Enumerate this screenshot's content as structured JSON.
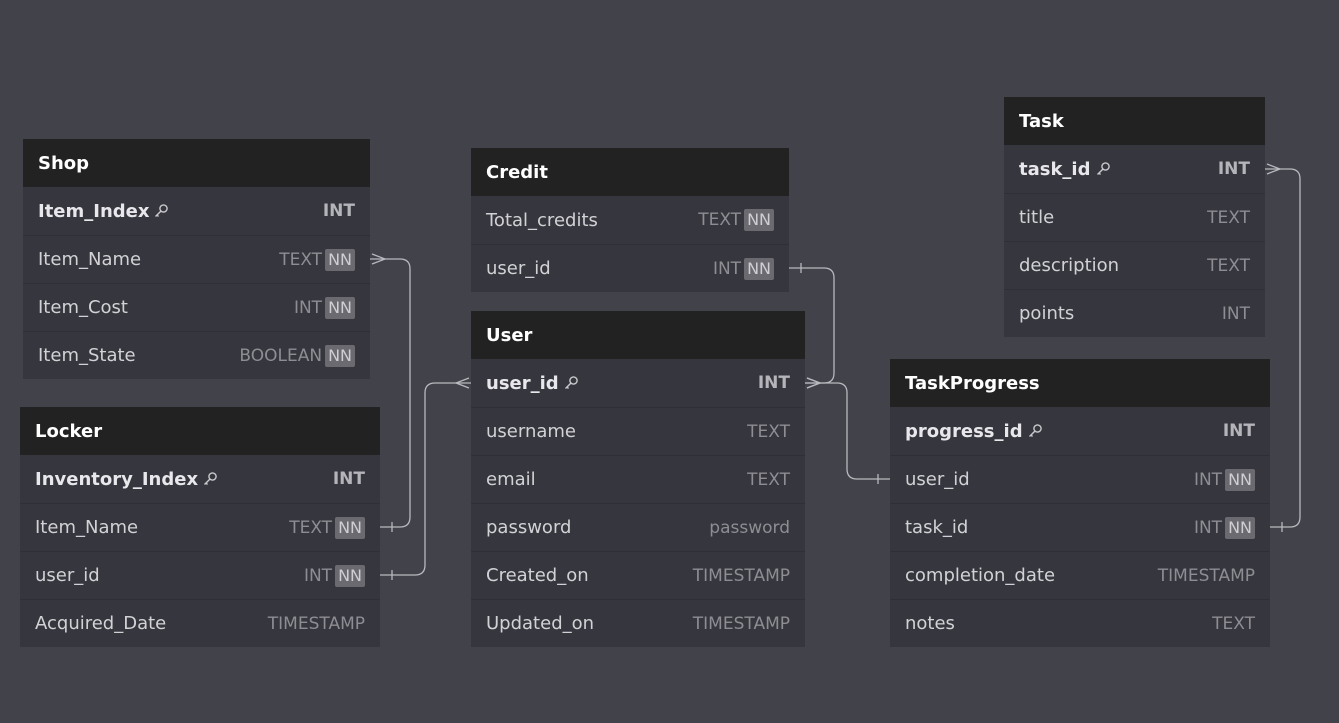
{
  "colors": {
    "canvas": "#42424b",
    "header_bg": "#222222",
    "row_bg": "#36363e",
    "link_stroke": "#b8b8be",
    "nn_badge": "#6a6a70"
  },
  "entities": {
    "shop": {
      "name": "Shop",
      "fields": [
        {
          "name": "Item_Index",
          "type": "INT",
          "nn": "",
          "pk": true
        },
        {
          "name": "Item_Name",
          "type": "TEXT",
          "nn": "NN",
          "pk": false
        },
        {
          "name": "Item_Cost",
          "type": "INT",
          "nn": "NN",
          "pk": false
        },
        {
          "name": "Item_State",
          "type": "BOOLEAN",
          "nn": "NN",
          "pk": false
        }
      ]
    },
    "locker": {
      "name": "Locker",
      "fields": [
        {
          "name": "Inventory_Index",
          "type": "INT",
          "nn": "",
          "pk": true
        },
        {
          "name": "Item_Name",
          "type": "TEXT",
          "nn": "NN",
          "pk": false
        },
        {
          "name": "user_id",
          "type": "INT",
          "nn": "NN",
          "pk": false
        },
        {
          "name": "Acquired_Date",
          "type": "TIMESTAMP",
          "nn": "",
          "pk": false
        }
      ]
    },
    "credit": {
      "name": "Credit",
      "fields": [
        {
          "name": "Total_credits",
          "type": "TEXT",
          "nn": "NN",
          "pk": false
        },
        {
          "name": "user_id",
          "type": "INT",
          "nn": "NN",
          "pk": false
        }
      ]
    },
    "user": {
      "name": "User",
      "fields": [
        {
          "name": "user_id",
          "type": "INT",
          "nn": "",
          "pk": true
        },
        {
          "name": "username",
          "type": "TEXT",
          "nn": "",
          "pk": false
        },
        {
          "name": "email",
          "type": "TEXT",
          "nn": "",
          "pk": false
        },
        {
          "name": "password",
          "type": "password",
          "nn": "",
          "pk": false
        },
        {
          "name": "Created_on",
          "type": "TIMESTAMP",
          "nn": "",
          "pk": false
        },
        {
          "name": "Updated_on",
          "type": "TIMESTAMP",
          "nn": "",
          "pk": false
        }
      ]
    },
    "task": {
      "name": "Task",
      "fields": [
        {
          "name": "task_id",
          "type": "INT",
          "nn": "",
          "pk": true
        },
        {
          "name": "title",
          "type": "TEXT",
          "nn": "",
          "pk": false
        },
        {
          "name": "description",
          "type": "TEXT",
          "nn": "",
          "pk": false
        },
        {
          "name": "points",
          "type": "INT",
          "nn": "",
          "pk": false
        }
      ]
    },
    "taskprogress": {
      "name": "TaskProgress",
      "fields": [
        {
          "name": "progress_id",
          "type": "INT",
          "nn": "",
          "pk": true
        },
        {
          "name": "user_id",
          "type": "INT",
          "nn": "NN",
          "pk": false
        },
        {
          "name": "task_id",
          "type": "INT",
          "nn": "NN",
          "pk": false
        },
        {
          "name": "completion_date",
          "type": "TIMESTAMP",
          "nn": "",
          "pk": false
        },
        {
          "name": "notes",
          "type": "TEXT",
          "nn": "",
          "pk": false
        }
      ]
    }
  },
  "relationships": [
    {
      "from": "shop.Item_Name",
      "from_end": "many",
      "to": "locker.Item_Name",
      "to_end": "one"
    },
    {
      "from": "user.user_id",
      "from_end": "many",
      "to": "locker.user_id",
      "to_end": "one"
    },
    {
      "from": "user.user_id",
      "from_end": "many",
      "to": "credit.user_id",
      "to_end": "one"
    },
    {
      "from": "user.user_id",
      "from_end": "many",
      "to": "taskprogress.user_id",
      "to_end": "one"
    },
    {
      "from": "task.task_id",
      "from_end": "many",
      "to": "taskprogress.task_id",
      "to_end": "one"
    }
  ]
}
